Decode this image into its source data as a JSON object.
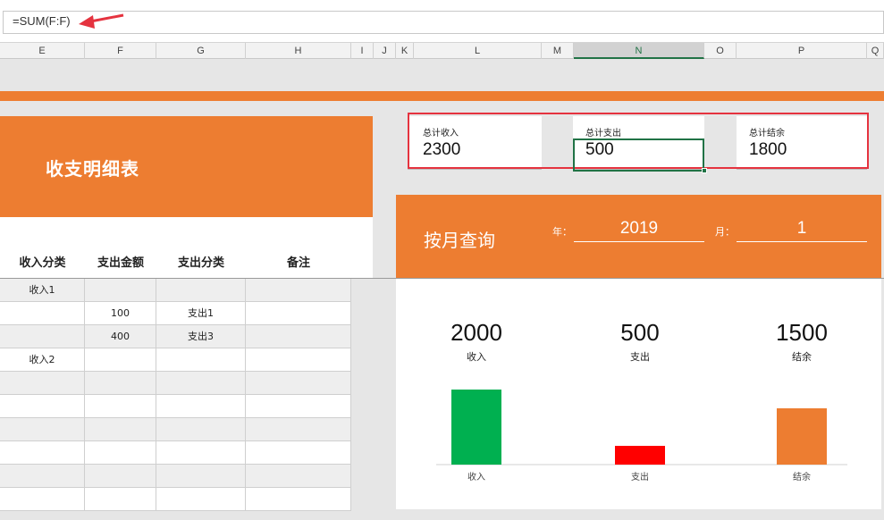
{
  "formula_bar": {
    "text": "=SUM(F:F)"
  },
  "columns": [
    {
      "id": "E",
      "label": "E"
    },
    {
      "id": "F",
      "label": "F"
    },
    {
      "id": "G",
      "label": "G"
    },
    {
      "id": "H",
      "label": "H"
    },
    {
      "id": "I",
      "label": "I"
    },
    {
      "id": "J",
      "label": "J"
    },
    {
      "id": "K",
      "label": "K"
    },
    {
      "id": "L",
      "label": "L"
    },
    {
      "id": "M",
      "label": "M"
    },
    {
      "id": "N",
      "label": "N"
    },
    {
      "id": "O",
      "label": "O"
    },
    {
      "id": "P",
      "label": "P"
    },
    {
      "id": "Q",
      "label": "Q"
    }
  ],
  "selected_column": "N",
  "left_sheet": {
    "title": "收支明细表",
    "headers": [
      "收入分类",
      "支出金额",
      "支出分类",
      "备注"
    ],
    "rows": [
      [
        "收入1",
        "",
        "",
        ""
      ],
      [
        "",
        "100",
        "支出1",
        ""
      ],
      [
        "",
        "400",
        "支出3",
        ""
      ],
      [
        "收入2",
        "",
        "",
        ""
      ],
      [
        "",
        "",
        "",
        ""
      ],
      [
        "",
        "",
        "",
        ""
      ],
      [
        "",
        "",
        "",
        ""
      ],
      [
        "",
        "",
        "",
        ""
      ],
      [
        "",
        "",
        "",
        ""
      ],
      [
        "",
        "",
        "",
        ""
      ]
    ]
  },
  "summary": {
    "income_label": "总计收入",
    "income_value": "2300",
    "expense_label": "总计支出",
    "expense_value": "500",
    "balance_label": "总计结余",
    "balance_value": "1800"
  },
  "monthly": {
    "title": "按月查询",
    "year_label": "年：",
    "year_value": "2019",
    "month_label": "月：",
    "month_value": "1"
  },
  "colors": {
    "accent": "#ed7d31",
    "income": "#00b050",
    "expense": "#ff0000",
    "balance": "#ed7d31"
  },
  "chart_data": {
    "type": "bar",
    "categories": [
      "收入",
      "支出",
      "结余"
    ],
    "values": [
      2000,
      500,
      1500
    ],
    "value_labels": [
      "2000",
      "500",
      "1500"
    ],
    "series_labels": [
      "收入",
      "支出",
      "结余"
    ],
    "title": "",
    "xlabel": "",
    "ylabel": ""
  }
}
